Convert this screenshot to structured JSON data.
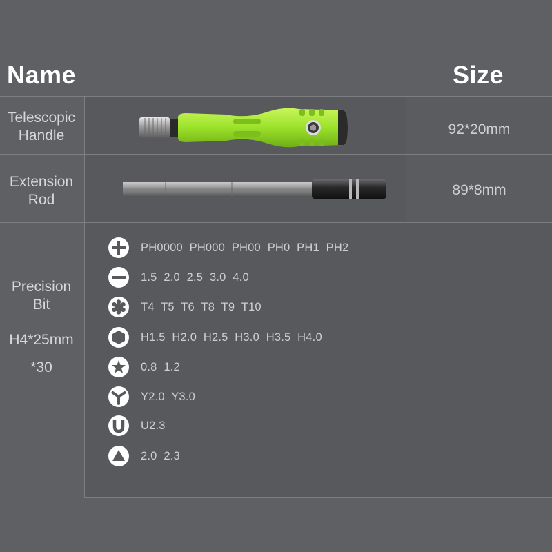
{
  "header": {
    "name": "Name",
    "size": "Size"
  },
  "rows": [
    {
      "label_line1": "Telescopic",
      "label_line2": "Handle",
      "size": "92*20mm",
      "image": "telescopic-handle-photo"
    },
    {
      "label_line1": "Extension",
      "label_line2": "Rod",
      "size": "89*8mm",
      "image": "extension-rod-photo"
    }
  ],
  "precision": {
    "label_line1": "Precision",
    "label_line2": "Bit",
    "spec": "H4*25mm",
    "count": "*30",
    "bits": [
      {
        "icon": "phillips-icon",
        "values": "PH0000 PH000 PH00 PH0 PH1 PH2"
      },
      {
        "icon": "slotted-icon",
        "values": "1.5 2.0 2.5 3.0 4.0"
      },
      {
        "icon": "torx-icon",
        "values": "T4 T5 T6 T8 T9 T10"
      },
      {
        "icon": "hex-icon",
        "values": "H1.5 H2.0 H2.5 H3.0 H3.5 H4.0"
      },
      {
        "icon": "pentalobe-icon",
        "values": "0.8 1.2"
      },
      {
        "icon": "tri-wing-icon",
        "values": "Y2.0 Y3.0"
      },
      {
        "icon": "u-type-icon",
        "values": "U2.3"
      },
      {
        "icon": "triangle-icon",
        "values": "2.0 2.3"
      }
    ]
  },
  "colors": {
    "background": "#5e6063",
    "cell": "#57595c",
    "handle_green": "#9be22a"
  }
}
